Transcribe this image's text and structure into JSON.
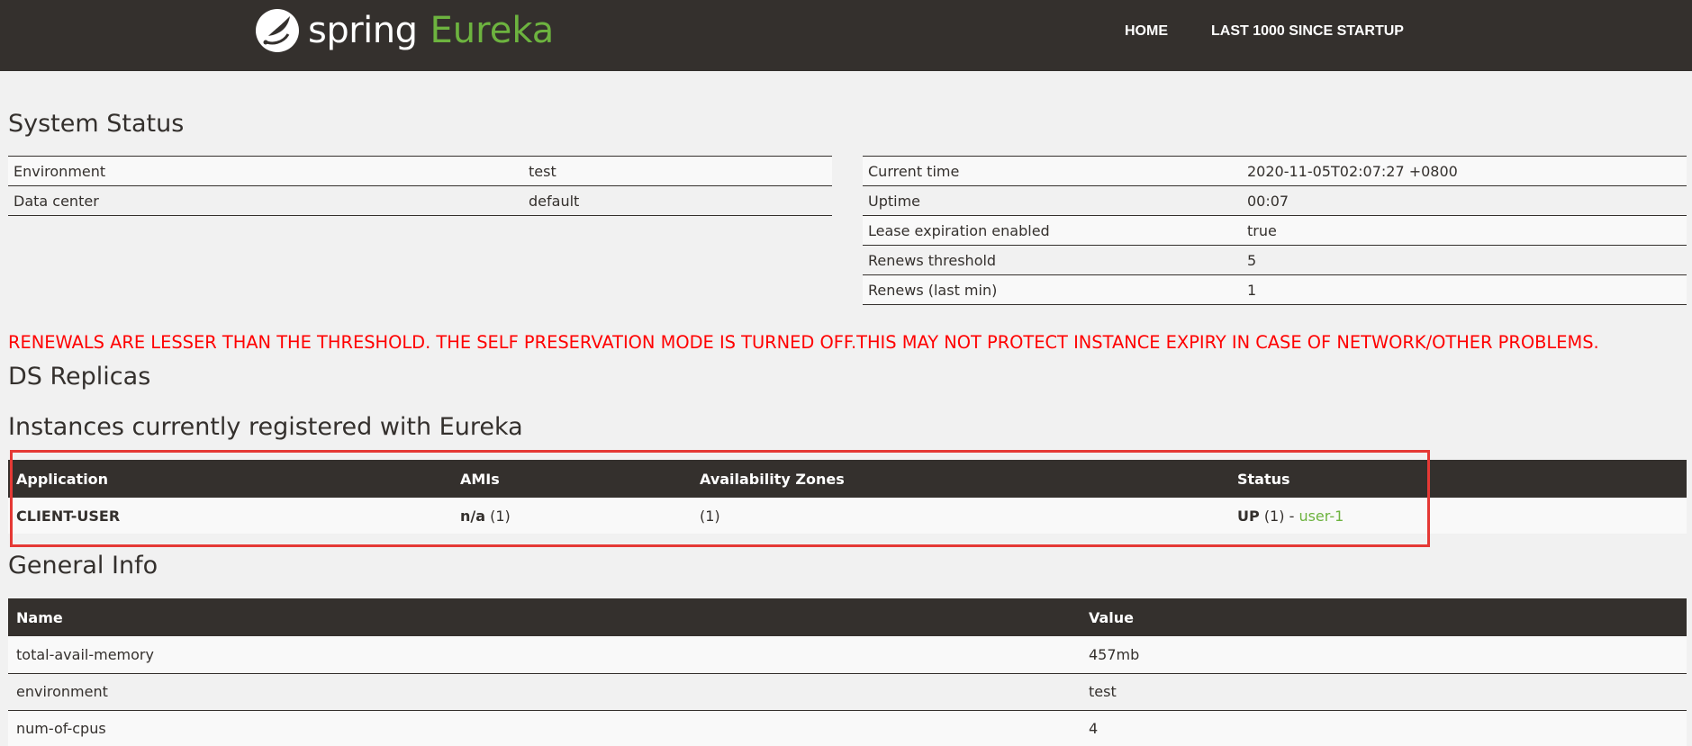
{
  "brand": {
    "spring": "spring",
    "eureka": "Eureka",
    "spring_color": "#ffffff",
    "eureka_color": "#6db33f"
  },
  "nav": {
    "home": "HOME",
    "last_1000": "LAST 1000 SINCE STARTUP"
  },
  "system_status": {
    "title": "System Status",
    "left": [
      {
        "label": "Environment",
        "value": "test"
      },
      {
        "label": "Data center",
        "value": "default"
      }
    ],
    "right": [
      {
        "label": "Current time",
        "value": "2020-11-05T02:07:27 +0800"
      },
      {
        "label": "Uptime",
        "value": "00:07"
      },
      {
        "label": "Lease expiration enabled",
        "value": "true"
      },
      {
        "label": "Renews threshold",
        "value": "5"
      },
      {
        "label": "Renews (last min)",
        "value": "1"
      }
    ]
  },
  "warning": "RENEWALS ARE LESSER THAN THE THRESHOLD. THE SELF PRESERVATION MODE IS TURNED OFF.THIS MAY NOT PROTECT INSTANCE EXPIRY IN CASE OF NETWORK/OTHER PROBLEMS.",
  "ds_replicas": {
    "title": "DS Replicas"
  },
  "instances": {
    "title": "Instances currently registered with Eureka",
    "headers": [
      "Application",
      "AMIs",
      "Availability Zones",
      "Status"
    ],
    "rows": [
      {
        "application": "CLIENT-USER",
        "amis_bold": "n/a",
        "amis_count": "(1)",
        "zones": "(1)",
        "status_bold": "UP",
        "status_count": "(1) -",
        "instance": "user-1"
      }
    ]
  },
  "general_info": {
    "title": "General Info",
    "headers": [
      "Name",
      "Value"
    ],
    "rows": [
      {
        "name": "total-avail-memory",
        "value": "457mb"
      },
      {
        "name": "environment",
        "value": "test"
      },
      {
        "name": "num-of-cpus",
        "value": "4"
      }
    ]
  },
  "colors": {
    "header_bg": "#34302d",
    "page_bg": "#f1f1f1",
    "accent_green": "#6db33f",
    "warning_red": "#ff0000",
    "highlight_red": "#e53935"
  }
}
